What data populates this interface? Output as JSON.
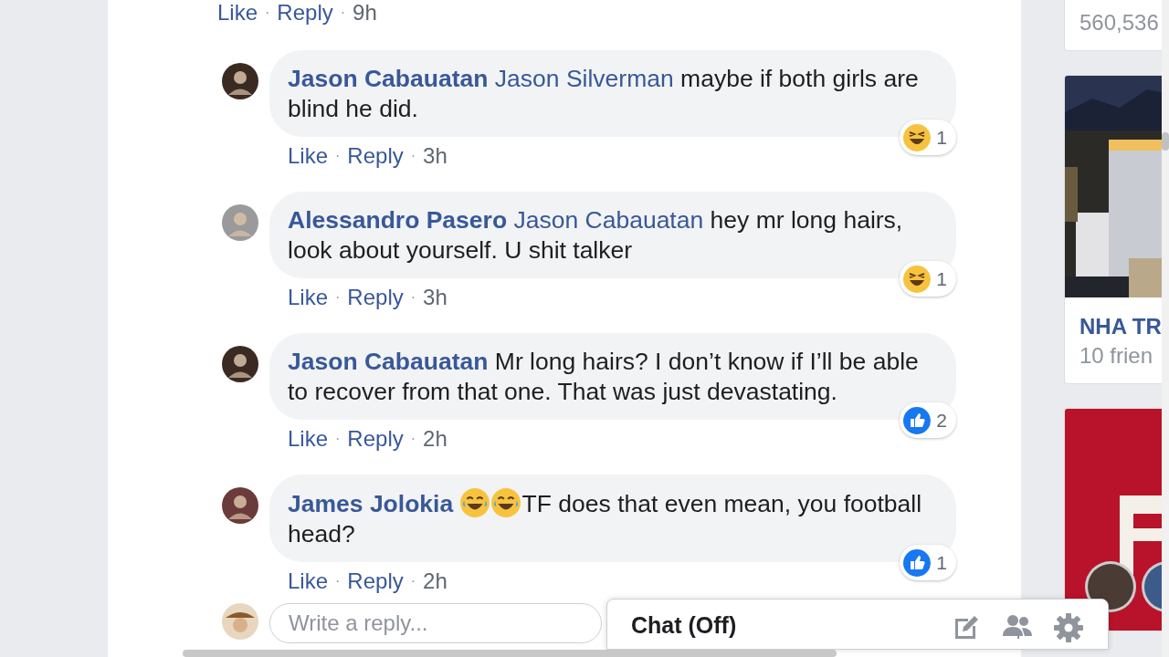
{
  "top_actions": {
    "like": "Like",
    "separators": [
      "·",
      "·"
    ],
    "reply": "Reply",
    "time": "9h"
  },
  "comments": [
    {
      "author": "Jason Cabauatan",
      "body": [
        {
          "kind": "mention",
          "text": "Jason Silverman"
        },
        {
          "kind": "text",
          "text": "maybe if both girls are blind he did."
        }
      ],
      "reaction": {
        "kind": "haha",
        "count": "1"
      },
      "like": "Like",
      "separators": [
        "·",
        "·"
      ],
      "reply": "Reply",
      "time": "3h"
    },
    {
      "author": "Alessandro Pasero",
      "body": [
        {
          "kind": "mention",
          "text": "Jason Cabauatan"
        },
        {
          "kind": "text",
          "text": "hey mr long hairs, look about yourself. U shit talker"
        }
      ],
      "reaction": {
        "kind": "haha",
        "count": "1"
      },
      "like": "Like",
      "separators": [
        "·",
        "·"
      ],
      "reply": "Reply",
      "time": "3h"
    },
    {
      "author": "Jason Cabauatan",
      "body": [
        {
          "kind": "text",
          "text": "Mr long hairs? I don’t know if I’ll be able to recover from that one. That was just devastating."
        }
      ],
      "reaction": {
        "kind": "like",
        "count": "2"
      },
      "like": "Like",
      "separators": [
        "·",
        "·"
      ],
      "reply": "Reply",
      "time": "2h"
    },
    {
      "author": "James Jolokia",
      "body": [
        {
          "kind": "emoji"
        },
        {
          "kind": "emoji"
        },
        {
          "kind": "text",
          "text": "TF does that even mean, you football head?"
        }
      ],
      "reaction": {
        "kind": "like",
        "count": "1"
      },
      "like": "Like",
      "separators": [
        "·",
        "·"
      ],
      "reply": "Reply",
      "time": "2h"
    }
  ],
  "reply_field": {
    "placeholder": "Write a reply..."
  },
  "sidebar": [
    {
      "kind": "stat",
      "subtitle": "560,536"
    },
    {
      "title": "NHA TR",
      "subtitle": "10 frien"
    },
    {
      "kind": "promo"
    }
  ],
  "chat": {
    "title": "Chat (Off)"
  }
}
